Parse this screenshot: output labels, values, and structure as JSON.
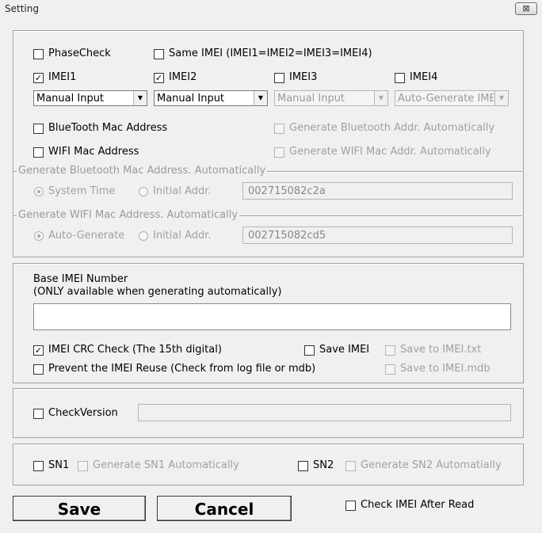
{
  "window": {
    "title": "Setting",
    "close_glyph": "⊠"
  },
  "top": {
    "phasecheck": {
      "label": "PhaseCheck",
      "checked": false
    },
    "same_imei": {
      "label": "Same IMEI (IMEI1=IMEI2=IMEI3=IMEI4)",
      "checked": false
    },
    "imei1": {
      "label": "IMEI1",
      "checked": true,
      "select": "Manual Input"
    },
    "imei2": {
      "label": "IMEI2",
      "checked": true,
      "select": "Manual Input"
    },
    "imei3": {
      "label": "IMEI3",
      "checked": false,
      "select": "Manual Input"
    },
    "imei4": {
      "label": "IMEI4",
      "checked": false,
      "select": "Auto-Generate IMEI"
    },
    "bt_mac": {
      "label": "BlueTooth Mac Address",
      "checked": false
    },
    "bt_auto": {
      "label": "Generate Bluetooth Addr. Automatically",
      "checked": false
    },
    "wifi_mac": {
      "label": "WIFI Mac Address",
      "checked": false
    },
    "wifi_auto": {
      "label": "Generate WIFI Mac Addr. Automatically",
      "checked": false
    },
    "bt_group": {
      "legend": "Generate Bluetooth Mac Address. Automatically",
      "opt1": "System Time",
      "opt2": "Initial Addr.",
      "addr": "002715082c2a"
    },
    "wifi_group": {
      "legend": "Generate WIFI Mac Address. Automatically",
      "opt1": "Auto-Generate",
      "opt2": "Initial Addr.",
      "addr": "002715082cd5"
    }
  },
  "imei_base": {
    "label_line1": "Base IMEI Number",
    "label_line2": "(ONLY available when generating automatically)",
    "value": "",
    "crc": {
      "label": "IMEI CRC Check (The 15th digital)",
      "checked": true
    },
    "save_imei": {
      "label": "Save IMEI",
      "checked": false
    },
    "save_txt": {
      "label": "Save to IMEI.txt",
      "checked": false
    },
    "prevent": {
      "label": "Prevent the IMEI Reuse (Check from log file or mdb)",
      "checked": false
    },
    "save_mdb": {
      "label": "Save to IMEI.mdb",
      "checked": false
    }
  },
  "version": {
    "label": "CheckVersion",
    "checked": false,
    "value": ""
  },
  "sn": {
    "sn1": {
      "label": "SN1",
      "checked": false
    },
    "sn1_auto": {
      "label": "Generate SN1 Automatically",
      "checked": false
    },
    "sn2": {
      "label": "SN2",
      "checked": false
    },
    "sn2_auto": {
      "label": "Generate SN2 Automatially",
      "checked": false
    }
  },
  "footer": {
    "save": "Save",
    "cancel": "Cancel",
    "check_after_read": {
      "label": "Check IMEI After Read",
      "checked": false
    }
  },
  "glyphs": {
    "check": "✓",
    "arrow": "▼"
  }
}
